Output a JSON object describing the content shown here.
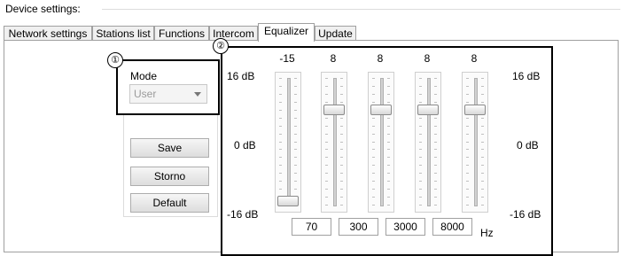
{
  "window": {
    "title": "Device settings:"
  },
  "tabs": [
    "Network settings",
    "Stations list",
    "Functions",
    "Intercom",
    "Equalizer",
    "Update"
  ],
  "active_tab": "Equalizer",
  "markers": [
    "①",
    "②"
  ],
  "mode": {
    "label": "Mode",
    "value": "User"
  },
  "buttons": {
    "save": "Save",
    "storno": "Storno",
    "default": "Default"
  },
  "equalizer": {
    "db_max": "16 dB",
    "db_mid": "0 dB",
    "db_min": "-16 dB",
    "range": [
      -16,
      16
    ],
    "bands": [
      {
        "value": "-15",
        "level": -15,
        "freq": "70"
      },
      {
        "value": "8",
        "level": 8,
        "freq": "300"
      },
      {
        "value": "8",
        "level": 8,
        "freq": "3000"
      },
      {
        "value": "8",
        "level": 8,
        "freq": "8000"
      },
      {
        "value": "8",
        "level": 8,
        "freq": ""
      }
    ],
    "unit": "Hz"
  }
}
